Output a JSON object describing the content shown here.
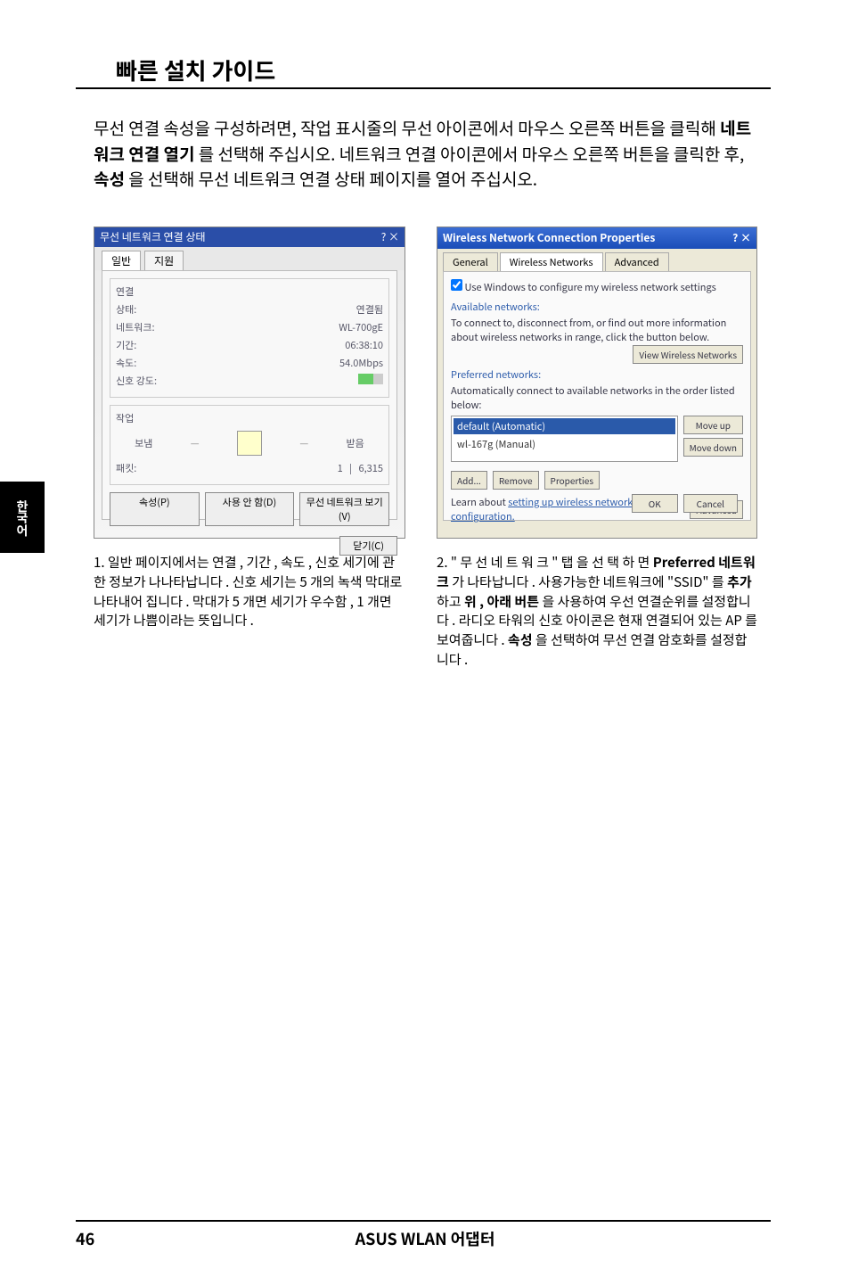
{
  "page": {
    "title": "빠른 설치 가이드",
    "body_text_parts": [
      "무선 연결 속성을 구성하려면, 작업 표시줄의 무선 아이콘에서 마우스 오른쪽 버튼을 클릭해 ",
      "네트워크 연결 열기",
      "를 선택해 주십시오. 네트워크 연결 아이콘에서 마우스 오른쪽 버튼을 클릭한 후, ",
      "속성",
      "을 선택해 무선 네트워크 연결 상태 페이지를 열어 주십시오."
    ],
    "side_tab": "한국어",
    "page_num": "46",
    "footer": "ASUS WLAN 어댑터"
  },
  "dlg_left": {
    "title": "무선 네트워크 연결 상태",
    "title_btns": "? ×",
    "tabs": {
      "general": "일반",
      "support": "지원"
    },
    "group1_label": "연결",
    "rows": {
      "status_label": "상태:",
      "status_value": "연결됨",
      "network_label": "네트워크:",
      "network_value": "WL-700gE",
      "duration_label": "기간:",
      "duration_value": "06:38:10",
      "speed_label": "속도:",
      "speed_value": "54.0Mbps",
      "signal_label": "신호 강도:"
    },
    "group2_label": "작업",
    "activity": {
      "sent_label": "보냄",
      "recv_label": "받음",
      "packets_label": "패킷:",
      "sent_val": "1",
      "recv_val": "6,315"
    },
    "buttons": {
      "props": "속성(P)",
      "disable": "사용 안 함(D)",
      "view": "무선 네트워크 보기(V)",
      "close": "닫기(C)"
    }
  },
  "dlg_right": {
    "title": "Wireless Network Connection Properties",
    "title_btns": "? ×",
    "tabs": {
      "general": "General",
      "wireless": "Wireless Networks",
      "advanced": "Advanced"
    },
    "chk_label": "Use Windows to configure my wireless network settings",
    "avail_head": "Available networks:",
    "avail_text": "To connect to, disconnect from, or find out more information about wireless networks in range, click the button below.",
    "view_btn": "View Wireless Networks",
    "pref_head": "Preferred networks:",
    "pref_text": "Automatically connect to available networks in the order listed below:",
    "list_item1": "default (Automatic)",
    "list_item2": "wl-167g (Manual)",
    "moveup": "Move up",
    "movedown": "Move down",
    "add": "Add...",
    "remove": "Remove",
    "properties": "Properties",
    "learn_text": "Learn about ",
    "learn_link": "setting up wireless network configuration.",
    "adv_btn": "Advanced",
    "ok": "OK",
    "cancel": "Cancel"
  },
  "captions": {
    "left": "1. 일반 페이지에서는 연결 , 기간 , 속도 , 신호 세기에 관한 정보가 나나타납니다 . 신호 세기는 5 개의 녹색 막대로 나타내어 집니다 . 막대가 5 개면 세기가 우수함 , 1 개면 세기가 나쁨이라는 뜻입니다 .",
    "right_parts": [
      "2. \" 무 선  네 트 워 크 \"  탭 을  선 택 하 면 ",
      "Preferred 네트워크",
      "가 나타납니다 . 사용가능한 네트워크에 \"SSID\" 를 ",
      "추가",
      "하고 ",
      "위 , 아래 버튼",
      "을 사용하여 우선 연결순위를 설정합니다 . 라디오 타워의 신호 아이콘은 현재 연결되어 있는 AP 를 보여줍니다 . ",
      "속성",
      "을 선택하여 무선 연결 암호화를 설정합니다 ."
    ]
  }
}
